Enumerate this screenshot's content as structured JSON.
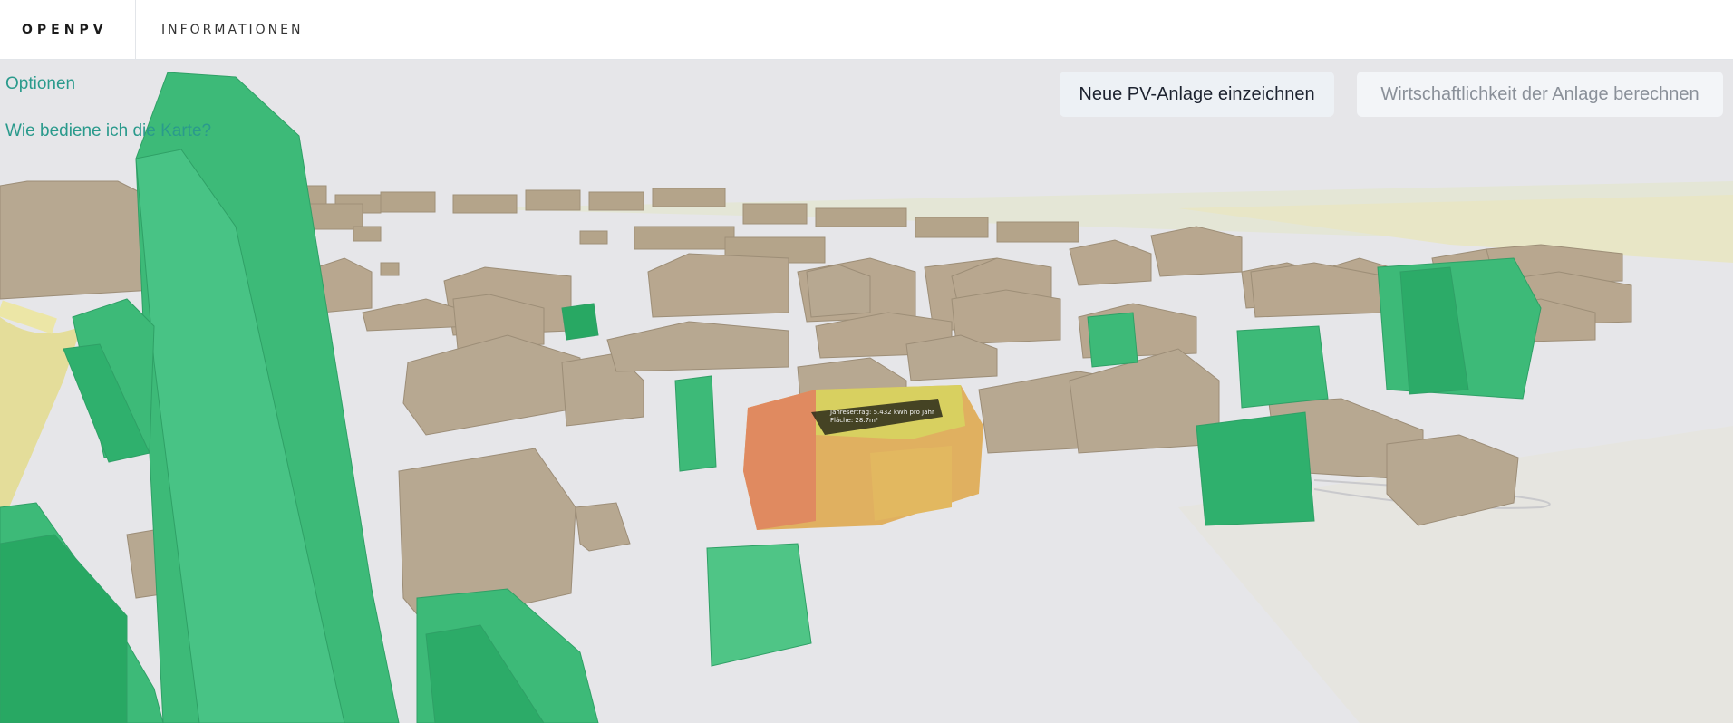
{
  "app": {
    "brand": "OPENPV",
    "nav_info": "INFORMATIONEN"
  },
  "map_links": {
    "options": "Optionen",
    "help": "Wie bediene ich die Karte?"
  },
  "actions": {
    "draw_label": "Neue PV-Anlage einzeichnen",
    "calc_label": "Wirtschaftlichkeit der Anlage berechnen"
  },
  "selected_building": {
    "annual_yield": "Jahresertrag: 5.432 kWh pro Jahr",
    "area": "Fläche: 28.7m²"
  },
  "colors": {
    "accent_link": "#2a9a8c",
    "building": "#b5a58d",
    "vegetation": "#3dba78",
    "selected_roof": "#d8d060"
  }
}
